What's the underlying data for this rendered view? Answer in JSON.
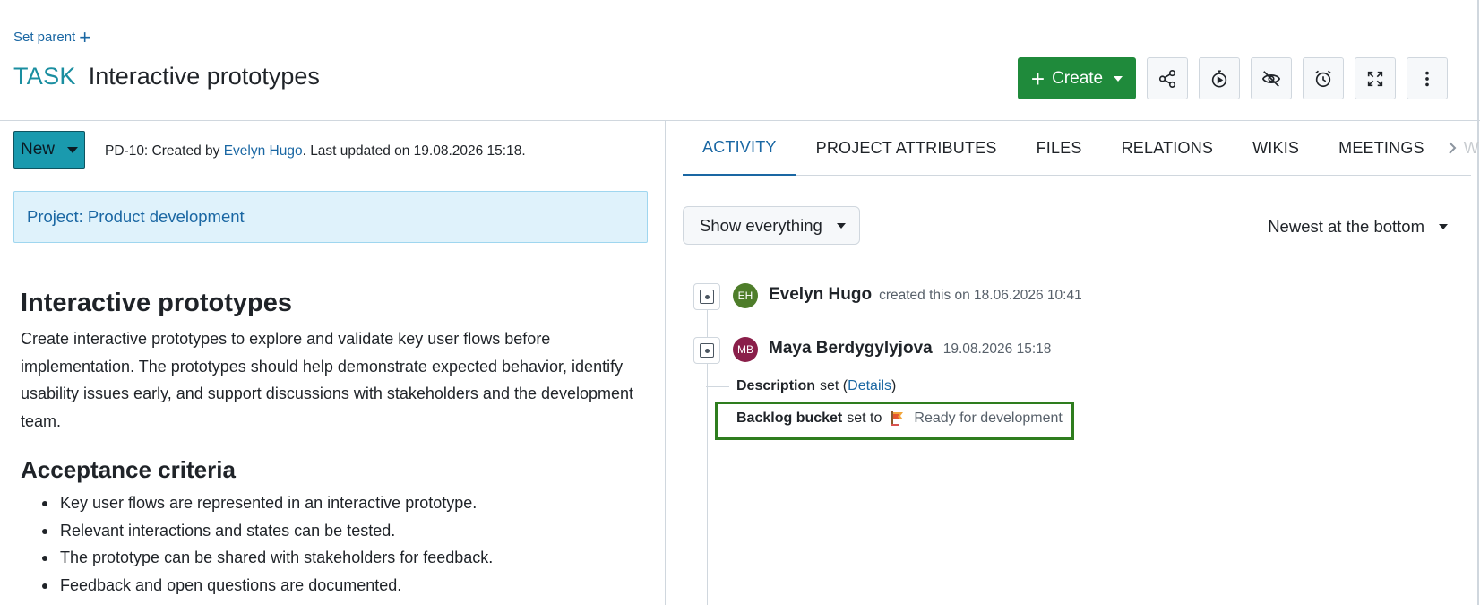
{
  "header": {
    "set_parent_label": "Set parent",
    "type_label": "TASK",
    "subject": "Interactive prototypes"
  },
  "toolbar": {
    "create_label": "Create",
    "icons": [
      "share-icon",
      "timer-icon",
      "unwatch-icon",
      "reminder-icon",
      "fullscreen-icon",
      "more-icon"
    ]
  },
  "status": {
    "label": "New",
    "color": "#1a9aae"
  },
  "meta": {
    "prefix": "PD-10: Created by ",
    "author": "Evelyn Hugo",
    "suffix": ". Last updated on 19.08.2026 15:18."
  },
  "project": {
    "label": "Project: Product development"
  },
  "description": {
    "title": "Interactive prototypes",
    "body": "Create interactive prototypes to explore and validate key user flows before implementation. The prototypes should help demonstrate expected behavior, identify usability issues early, and support discussions with stakeholders and the development team.",
    "acceptance_title": "Acceptance criteria",
    "criteria": [
      "Key user flows are represented in an interactive prototype.",
      "Relevant interactions and states can be tested.",
      "The prototype can be shared with stakeholders for feedback.",
      "Feedback and open questions are documented."
    ]
  },
  "tabs": [
    {
      "label": "ACTIVITY",
      "active": true
    },
    {
      "label": "PROJECT ATTRIBUTES",
      "active": false
    },
    {
      "label": "FILES",
      "active": false
    },
    {
      "label": "RELATIONS",
      "active": false
    },
    {
      "label": "WIKIS",
      "active": false
    },
    {
      "label": "MEETINGS",
      "active": false
    },
    {
      "label": "W",
      "active": false
    }
  ],
  "activity": {
    "filter_label": "Show everything",
    "sort_label": "Newest at the bottom",
    "entries": [
      {
        "initials": "EH",
        "avatar_color": "#4e7d2a",
        "user": "Evelyn Hugo",
        "text": "created this on 18.06.2026 10:41"
      },
      {
        "initials": "MB",
        "avatar_color": "#8a1f4a",
        "user": "Maya Berdygylyjova",
        "text": "19.08.2026 15:18"
      }
    ],
    "details": {
      "description_field": "Description",
      "description_set": "set (",
      "details_link": "Details",
      "description_close": ")",
      "bucket_field": "Backlog bucket",
      "bucket_set": "set to",
      "bucket_value": "Ready for development"
    }
  },
  "colors": {
    "accent": "#1a67a3",
    "create": "#1f8a3b",
    "highlight": "#2e7d1e",
    "type": "#1a8ea0"
  }
}
